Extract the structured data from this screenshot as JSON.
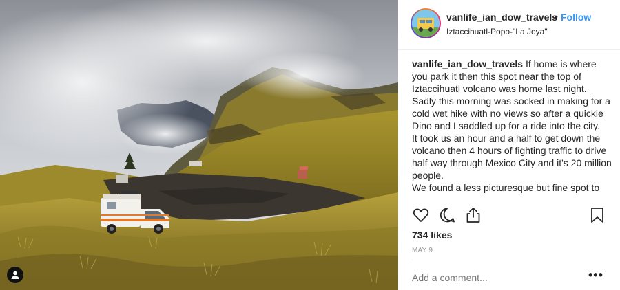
{
  "post": {
    "username": "vanlife_ian_dow_travels",
    "dot": "•",
    "follow_label": "Follow",
    "location": "Iztaccihuatl-Popo-\"La Joya\"",
    "caption_user": "vanlife_ian_dow_travels",
    "caption_p1": " If home is where you park it then this spot near the top of Iztaccihuatl volcano was home last night. Sadly this morning was socked in making for a cold wet hike with no views so after a quickie Dino and I saddled up for a ride into the city.",
    "caption_p2": "It took us an hour and a half to get down the volcano then 4 hours of fighting traffic to drive half way through Mexico City and it's 20 million people.",
    "caption_p3": "We found a less picturesque but fine spot to",
    "likes": "734 likes",
    "date": "MAY 9",
    "comment_placeholder": "Add a comment...",
    "more_label": "•••"
  },
  "icons": {
    "like": "heart-icon",
    "comment": "comment-icon",
    "share": "share-icon",
    "save": "bookmark-icon",
    "user_tag": "user-tag-icon"
  },
  "colors": {
    "link": "#3897f0",
    "text": "#262626",
    "muted": "#999999"
  }
}
